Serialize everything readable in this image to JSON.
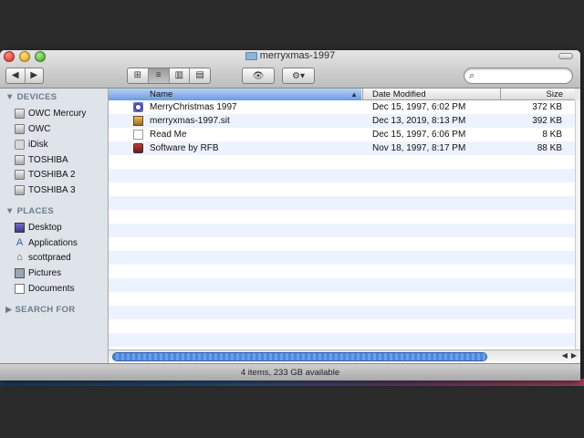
{
  "window": {
    "title": "merryxmas-1997"
  },
  "toolbar": {
    "back_glyph": "◀",
    "forward_glyph": "▶",
    "view_icons": [
      "⊞",
      "≡",
      "▥",
      "▤"
    ],
    "eye_glyph": "👁",
    "gear_glyph": "⚙▾",
    "search_glyph": "⌕",
    "search_value": ""
  },
  "sidebar": {
    "devices_header": "▼ DEVICES",
    "devices": [
      {
        "label": "OWC Mercury",
        "icon": "disk-icon"
      },
      {
        "label": "OWC",
        "icon": "disk-icon"
      },
      {
        "label": "iDisk",
        "icon": "idisk-icon"
      },
      {
        "label": "TOSHIBA",
        "icon": "disk-icon"
      },
      {
        "label": "TOSHIBA 2",
        "icon": "disk-icon"
      },
      {
        "label": "TOSHIBA 3",
        "icon": "disk-icon"
      }
    ],
    "places_header": "▼ PLACES",
    "places": [
      {
        "label": "Desktop",
        "icon": "desktop-icon"
      },
      {
        "label": "Applications",
        "icon": "applications-icon"
      },
      {
        "label": "scottpraed",
        "icon": "home-icon"
      },
      {
        "label": "Pictures",
        "icon": "pictures-icon"
      },
      {
        "label": "Documents",
        "icon": "documents-icon"
      }
    ],
    "search_header": "▶ SEARCH FOR"
  },
  "columns": {
    "name": "Name",
    "date": "Date Modified",
    "size": "Size",
    "sort_glyph": "▲"
  },
  "files": [
    {
      "name": "MerryChristmas 1997",
      "date": "Dec 15, 1997, 6:02 PM",
      "size": "372 KB",
      "icon": "app-icon"
    },
    {
      "name": "merryxmas-1997.sit",
      "date": "Dec 13, 2019, 8:13 PM",
      "size": "392 KB",
      "icon": "archive-icon"
    },
    {
      "name": "Read Me",
      "date": "Dec 15, 1997, 6:06 PM",
      "size": "8 KB",
      "icon": "document-icon"
    },
    {
      "name": "Software by RFB",
      "date": "Nov 18, 1997, 8:17 PM",
      "size": "88 KB",
      "icon": "app-icon"
    }
  ],
  "hscroll": {
    "left_glyph": "◀",
    "right_glyph": "▶"
  },
  "status": {
    "text": "4 items, 233 GB available"
  },
  "colors": {
    "selection_header": "#6c9be0",
    "alt_row": "#edf3fe",
    "sidebar_bg": "#dee4ea"
  }
}
